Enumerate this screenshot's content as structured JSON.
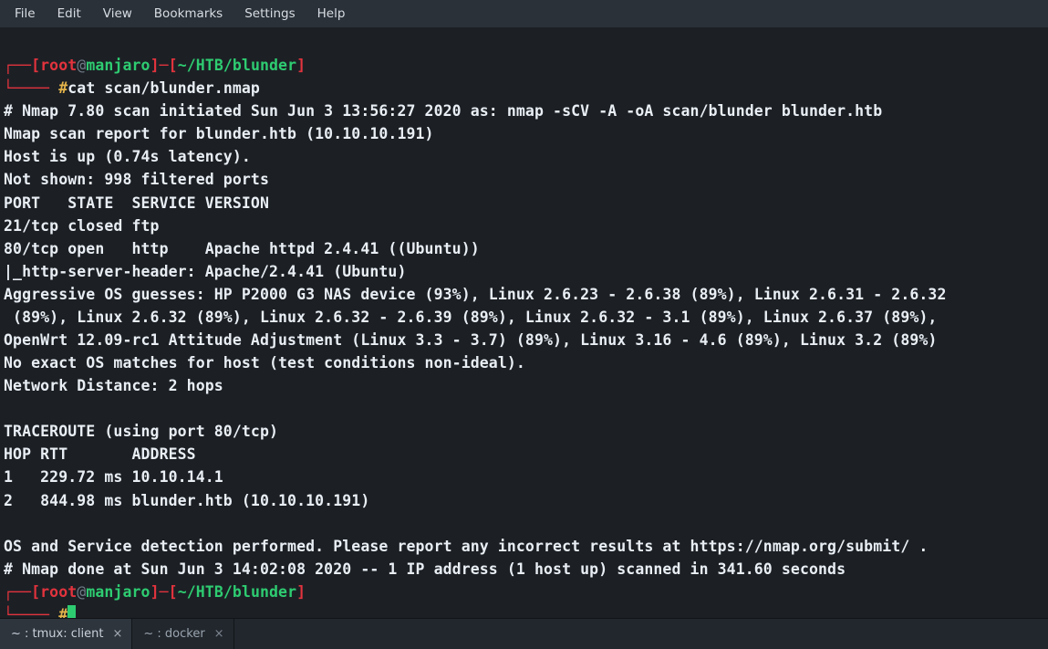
{
  "menubar": {
    "items": [
      "File",
      "Edit",
      "View",
      "Bookmarks",
      "Settings",
      "Help"
    ]
  },
  "prompt1": {
    "top_open": "┌──[",
    "user": "root",
    "at": "@",
    "host": "manjaro",
    "mid": "]─[",
    "cwd": "~/HTB/blunder",
    "close": "]",
    "bottom": "└──── ",
    "hash": "#",
    "cmd": "cat scan/blunder.nmap"
  },
  "output": {
    "l1": "# Nmap 7.80 scan initiated Sun Jun 3 13:56:27 2020 as: nmap -sCV -A -oA scan/blunder blunder.htb",
    "l2": "Nmap scan report for blunder.htb (10.10.10.191)",
    "l3": "Host is up (0.74s latency).",
    "l4": "Not shown: 998 filtered ports",
    "l5": "PORT   STATE  SERVICE VERSION",
    "l6": "21/tcp closed ftp",
    "l7": "80/tcp open   http    Apache httpd 2.4.41 ((Ubuntu))",
    "l8": "|_http-server-header: Apache/2.4.41 (Ubuntu)",
    "l9": "Aggressive OS guesses: HP P2000 G3 NAS device (93%), Linux 2.6.23 - 2.6.38 (89%), Linux 2.6.31 - 2.6.32",
    "l10": " (89%), Linux 2.6.32 (89%), Linux 2.6.32 - 2.6.39 (89%), Linux 2.6.32 - 3.1 (89%), Linux 2.6.37 (89%),",
    "l11": "OpenWrt 12.09-rc1 Attitude Adjustment (Linux 3.3 - 3.7) (89%), Linux 3.16 - 4.6 (89%), Linux 3.2 (89%)",
    "l12": "No exact OS matches for host (test conditions non-ideal).",
    "l13": "Network Distance: 2 hops",
    "l14": "",
    "l15": "TRACEROUTE (using port 80/tcp)",
    "l16": "HOP RTT       ADDRESS",
    "l17": "1   229.72 ms 10.10.14.1",
    "l18": "2   844.98 ms blunder.htb (10.10.10.191)",
    "l19": "",
    "l20": "OS and Service detection performed. Please report any incorrect results at https://nmap.org/submit/ .",
    "l21": "# Nmap done at Sun Jun 3 14:02:08 2020 -- 1 IP address (1 host up) scanned in 341.60 seconds"
  },
  "prompt2": {
    "top_open": "┌──[",
    "user": "root",
    "at": "@",
    "host": "manjaro",
    "mid": "]─[",
    "cwd": "~/HTB/blunder",
    "close": "]",
    "bottom": "└──── ",
    "hash": "#"
  },
  "tabs": {
    "t1": {
      "label": "~ : tmux: client",
      "active": true
    },
    "t2": {
      "label": "~ : docker",
      "active": false
    },
    "close": "×"
  }
}
